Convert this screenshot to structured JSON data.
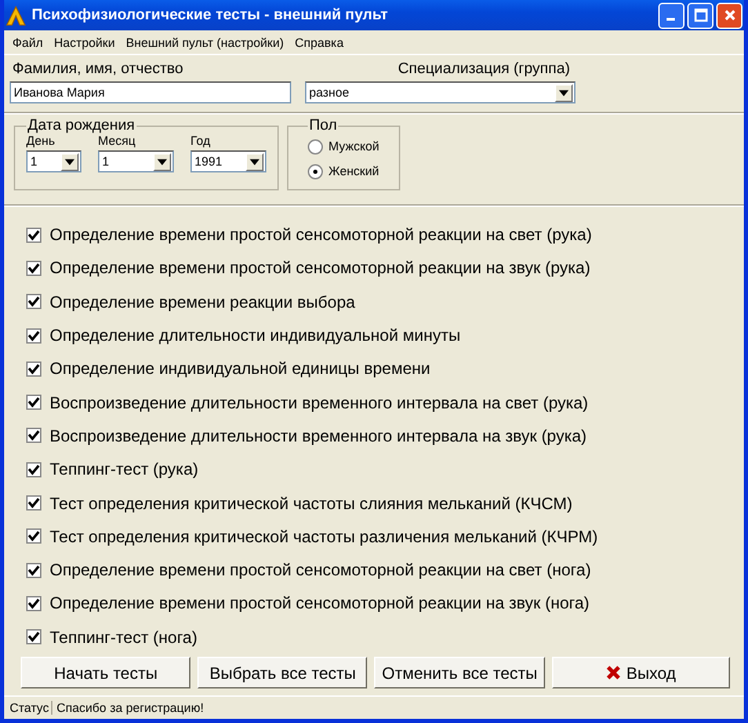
{
  "window": {
    "title": "Психофизиологические тесты - внешний пульт"
  },
  "menu": [
    "Файл",
    "Настройки",
    "Внешний пульт (настройки)",
    "Справка"
  ],
  "name_field": {
    "label": "Фамилия, имя, отчество",
    "value": "Иванова Мария"
  },
  "group_field": {
    "label": "Специализация (группа)",
    "value": "разное"
  },
  "birth_date": {
    "title": "Дата рождения",
    "fields": [
      {
        "label": "День",
        "value": "1"
      },
      {
        "label": "Месяц",
        "value": "1"
      },
      {
        "label": "Год",
        "value": "1991"
      }
    ]
  },
  "gender": {
    "title": "Пол",
    "options": [
      {
        "label": "Мужской",
        "selected": false
      },
      {
        "label": "Женский",
        "selected": true
      }
    ]
  },
  "tests": [
    {
      "label": "Определение времени простой сенсомоторной реакции на свет (рука)",
      "checked": true
    },
    {
      "label": "Определение времени простой сенсомоторной реакции на звук (рука)",
      "checked": true
    },
    {
      "label": "Определение времени реакции выбора",
      "checked": true
    },
    {
      "label": "Определение длительности индивидуальной минуты",
      "checked": true
    },
    {
      "label": "Определение индивидуальной единицы времени",
      "checked": true
    },
    {
      "label": "Воспроизведение длительности временного интервала на свет (рука)",
      "checked": true
    },
    {
      "label": "Воспроизведение длительности временного интервала на звук (рука)",
      "checked": true
    },
    {
      "label": "Теппинг-тест (рука)",
      "checked": true
    },
    {
      "label": "Тест определения критической частоты слияния мельканий (КЧСМ)",
      "checked": true
    },
    {
      "label": "Тест определения критической частоты различения мельканий (КЧРМ)",
      "checked": true
    },
    {
      "label": "Определение времени простой сенсомоторной реакции на свет (нога)",
      "checked": true
    },
    {
      "label": "Определение времени простой сенсомоторной реакции на звук (нога)",
      "checked": true
    },
    {
      "label": "Теппинг-тест (нога)",
      "checked": true
    }
  ],
  "buttons": [
    {
      "label": "Начать тесты",
      "kind": "plain"
    },
    {
      "label": "Выбрать все тесты",
      "kind": "plain"
    },
    {
      "label": "Отменить все тесты",
      "kind": "plain"
    },
    {
      "label": "Выход",
      "kind": "exit"
    }
  ],
  "status_bar": {
    "label": "Статус",
    "message": "Спасибо за регистрацию!"
  }
}
